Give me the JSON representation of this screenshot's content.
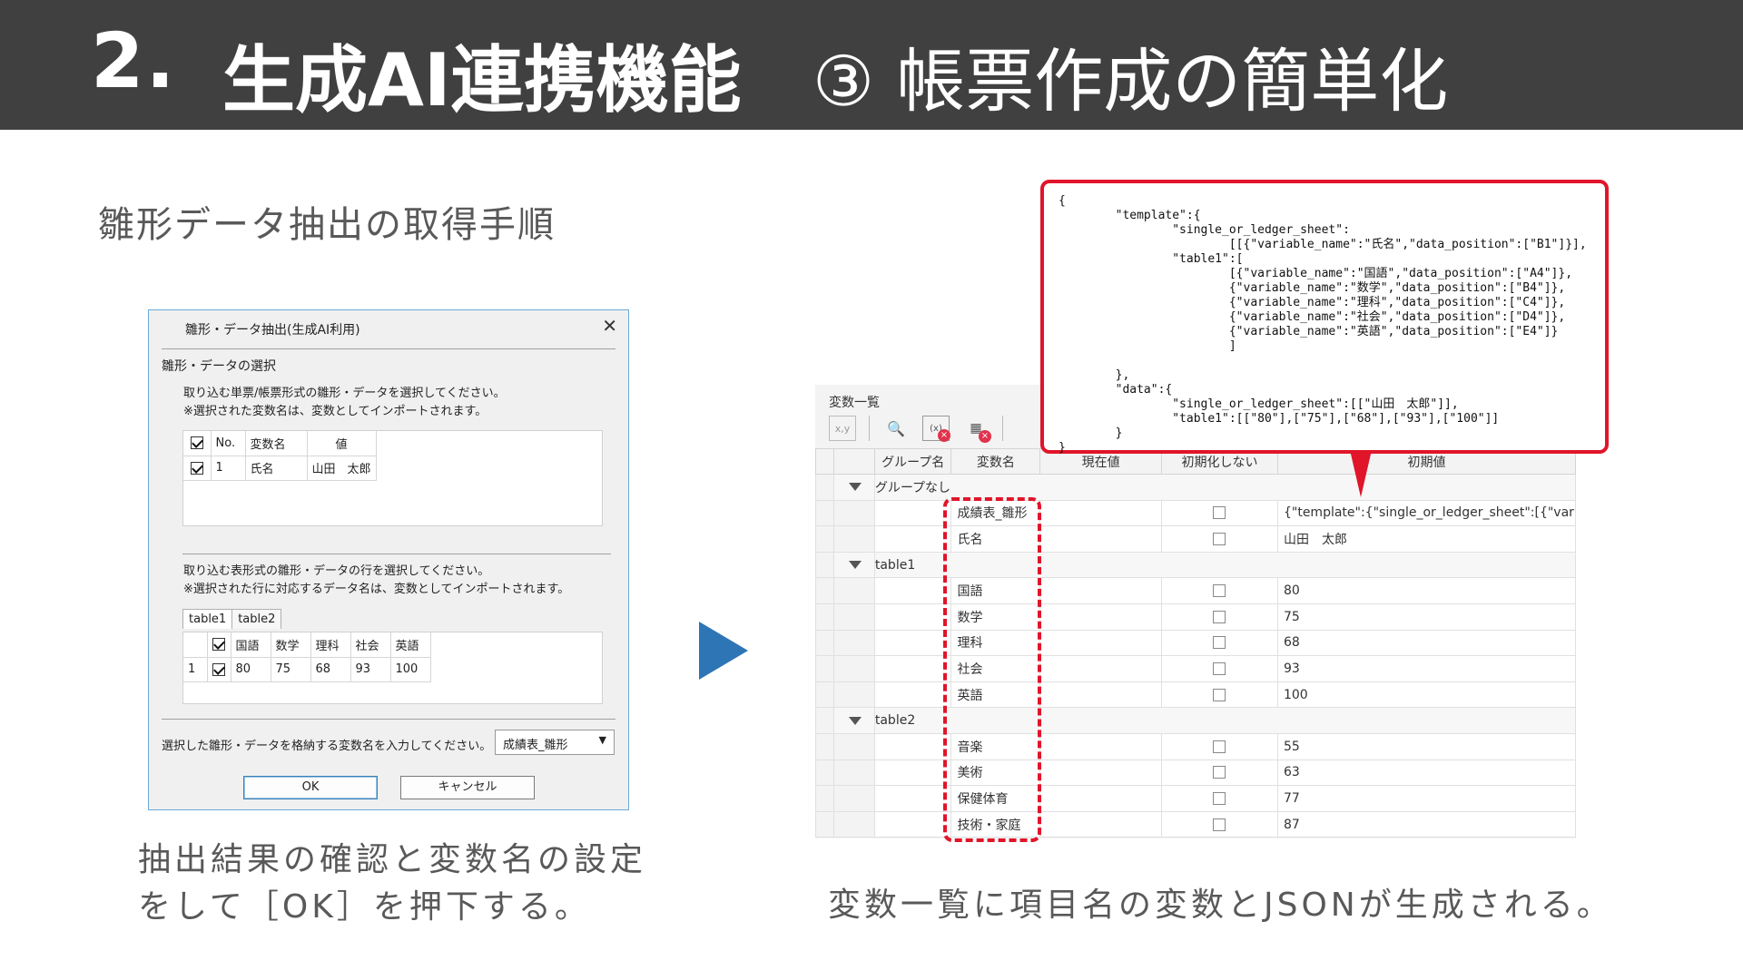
{
  "header": {
    "number": "2.",
    "title": "生成AI連携機能",
    "subtitle": "③ 帳票作成の簡単化"
  },
  "section_label": "雛形データ抽出の取得手順",
  "dialog": {
    "title": "雛形・データ抽出(生成AI利用)",
    "section": "雛形・データの選択",
    "message1_line1": "取り込む単票/帳票形式の雛形・データを選択してください。",
    "message1_line2": "※選択された変数名は、変数としてインポートされます。",
    "grid1_headers": [
      "No.",
      "変数名",
      "値"
    ],
    "grid1_rows": [
      [
        "1",
        "氏名",
        "山田　太郎"
      ]
    ],
    "message2_line1": "取り込む表形式の雛形・データの行を選択してください。",
    "message2_line2": "※選択された行に対応するデータ名は、変数としてインポートされます。",
    "tabs": [
      "table1",
      "table2"
    ],
    "grid2_headers": [
      "国語",
      "数学",
      "理科",
      "社会",
      "英語"
    ],
    "grid2_rows": [
      [
        "1",
        "80",
        "75",
        "68",
        "93",
        "100"
      ]
    ],
    "prompt": "選択した雛形・データを格納する変数名を入力してください。",
    "combo_value": "成績表_雛形",
    "ok_label": "OK",
    "cancel_label": "キャンセル"
  },
  "caption_left_line1": "抽出結果の確認と変数名の設定",
  "caption_left_line2": "をして［OK］を押下する。",
  "caption_right": "変数一覧に項目名の変数とJSONが生成される。",
  "var_panel": {
    "title": "変数一覧",
    "columns": [
      "グループ名",
      "変数名",
      "現在値",
      "初期化しない",
      "初期値"
    ],
    "rows": [
      {
        "type": "group",
        "label": "グループなし"
      },
      {
        "type": "var",
        "name": "成績表_雛形",
        "value": "{\"template\":{\"single_or_ledger_sheet\":[{\"variab"
      },
      {
        "type": "var",
        "name": "氏名",
        "value": "山田　太郎"
      },
      {
        "type": "group",
        "label": "table1"
      },
      {
        "type": "var",
        "name": "国語",
        "value": "80"
      },
      {
        "type": "var",
        "name": "数学",
        "value": "75"
      },
      {
        "type": "var",
        "name": "理科",
        "value": "68"
      },
      {
        "type": "var",
        "name": "社会",
        "value": "93"
      },
      {
        "type": "var",
        "name": "英語",
        "value": "100"
      },
      {
        "type": "group",
        "label": "table2"
      },
      {
        "type": "var",
        "name": "音楽",
        "value": "55"
      },
      {
        "type": "var",
        "name": "美術",
        "value": "63"
      },
      {
        "type": "var",
        "name": "保健体育",
        "value": "77"
      },
      {
        "type": "var",
        "name": "技術・家庭",
        "value": "87"
      }
    ]
  },
  "json_callout": "{\n        \"template\":{\n                \"single_or_ledger_sheet\":\n                        [[{\"variable_name\":\"氏名\",\"data_position\":[\"B1\"]}],\n                \"table1\":[\n                        [{\"variable_name\":\"国語\",\"data_position\":[\"A4\"]},\n                        {\"variable_name\":\"数学\",\"data_position\":[\"B4\"]},\n                        {\"variable_name\":\"理科\",\"data_position\":[\"C4\"]},\n                        {\"variable_name\":\"社会\",\"data_position\":[\"D4\"]},\n                        {\"variable_name\":\"英語\",\"data_position\":[\"E4\"]}\n                        ]\n\n        },\n        \"data\":{\n                \"single_or_ledger_sheet\":[[\"山田　太郎\"]],\n                \"table1\":[[\"80\"],[\"75\"],[\"68\"],[\"93\"],[\"100\"]]\n        }\n}",
  "colors": {
    "header_bg": "#404040",
    "accent_red": "#e0152a",
    "arrow_blue": "#2e75b6"
  }
}
